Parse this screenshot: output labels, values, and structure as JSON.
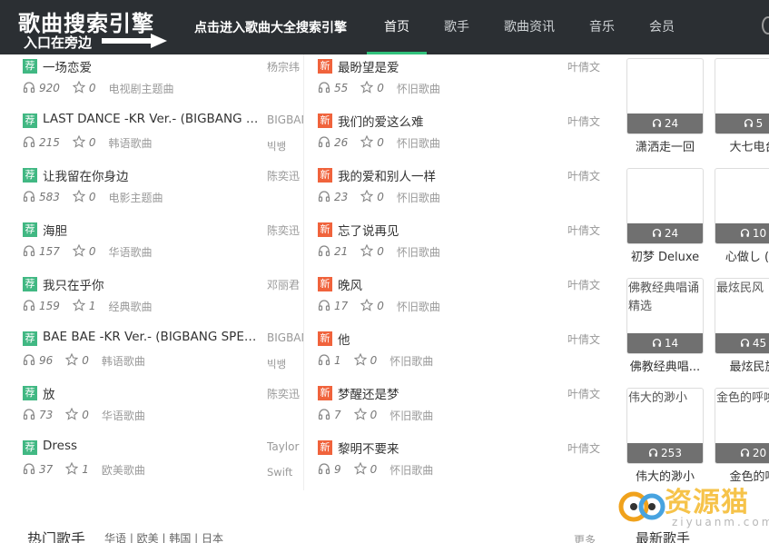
{
  "header": {
    "logo_line1": "歌曲搜索引擎",
    "logo_line2": "入口在旁边",
    "entry_link": "点击进入歌曲大全搜索引擎",
    "nav": [
      "首页",
      "歌手",
      "歌曲资讯",
      "音乐",
      "会员"
    ],
    "active_nav": 0
  },
  "tags": {
    "recommend": "荐",
    "new": "新"
  },
  "left_songs": [
    {
      "title": "一场恋爱",
      "plays": "920",
      "favs": "0",
      "category": "电视剧主题曲",
      "singer": "杨宗纬",
      "singer2": ""
    },
    {
      "title": "LAST DANCE -KR Ver.- (BIGBANG SPECIAL EDITION)",
      "plays": "215",
      "favs": "0",
      "category": "韩语歌曲",
      "singer": "BIGBANG",
      "singer2": "빅뱅"
    },
    {
      "title": "让我留在你身边",
      "plays": "583",
      "favs": "0",
      "category": "电影主题曲",
      "singer": "陈奕迅",
      "singer2": ""
    },
    {
      "title": "海胆",
      "plays": "157",
      "favs": "0",
      "category": "华语歌曲",
      "singer": "陈奕迅",
      "singer2": ""
    },
    {
      "title": "我只在乎你",
      "plays": "159",
      "favs": "1",
      "category": "经典歌曲",
      "singer": "邓丽君",
      "singer2": ""
    },
    {
      "title": "BAE BAE -KR Ver.- (BIGBANG SPECIAL EDITION)",
      "plays": "96",
      "favs": "0",
      "category": "韩语歌曲",
      "singer": "BIGBANG",
      "singer2": "빅뱅"
    },
    {
      "title": "放",
      "plays": "73",
      "favs": "0",
      "category": "华语歌曲",
      "singer": "陈奕迅",
      "singer2": ""
    },
    {
      "title": "Dress",
      "plays": "37",
      "favs": "1",
      "category": "欧美歌曲",
      "singer": "Taylor",
      "singer2": "Swift"
    }
  ],
  "mid_songs": [
    {
      "title": "最盼望是爱",
      "plays": "55",
      "favs": "0",
      "category": "怀旧歌曲",
      "singer": "叶倩文"
    },
    {
      "title": "我们的爱这么难",
      "plays": "26",
      "favs": "0",
      "category": "怀旧歌曲",
      "singer": "叶倩文"
    },
    {
      "title": "我的爱和别人一样",
      "plays": "23",
      "favs": "0",
      "category": "怀旧歌曲",
      "singer": "叶倩文"
    },
    {
      "title": "忘了说再见",
      "plays": "21",
      "favs": "0",
      "category": "怀旧歌曲",
      "singer": "叶倩文"
    },
    {
      "title": "晚风",
      "plays": "17",
      "favs": "0",
      "category": "怀旧歌曲",
      "singer": "叶倩文"
    },
    {
      "title": "他",
      "plays": "1",
      "favs": "0",
      "category": "怀旧歌曲",
      "singer": "叶倩文"
    },
    {
      "title": "梦醒还是梦",
      "plays": "7",
      "favs": "0",
      "category": "怀旧歌曲",
      "singer": "叶倩文"
    },
    {
      "title": "黎明不要来",
      "plays": "9",
      "favs": "0",
      "category": "怀旧歌曲",
      "singer": "叶倩文"
    }
  ],
  "albums": [
    {
      "alt": "",
      "plays": "24",
      "label": "潇洒走一回"
    },
    {
      "alt": "",
      "plays": "5",
      "label": "大七电台"
    },
    {
      "alt": "",
      "plays": "24",
      "label": "初梦 Deluxe"
    },
    {
      "alt": "",
      "plays": "10",
      "label": "心做し (无"
    },
    {
      "alt": "佛教经典唱诵精选",
      "plays": "14",
      "label": "佛教经典唱..."
    },
    {
      "alt": "最炫民风",
      "plays": "45",
      "label": "最炫民族"
    },
    {
      "alt": "伟大的渺小",
      "plays": "253",
      "label": "伟大的渺小"
    },
    {
      "alt": "金色的呼唤",
      "plays": "20",
      "label": "金色的呼"
    }
  ],
  "bottom": {
    "hot_singers": "热门歌手",
    "filters": "华语 | 欧美 | 韩国 | 日本",
    "more": "更多",
    "new_singers": "最新歌手"
  },
  "watermark": {
    "text": "资源猫",
    "sub": "ziyuanm.com"
  }
}
